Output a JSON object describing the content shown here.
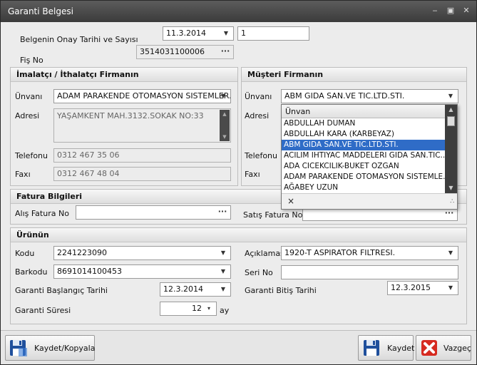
{
  "window": {
    "title": "Garanti Belgesi",
    "minimize": "‒",
    "restore": "▣",
    "close": "✕"
  },
  "header": {
    "onay_label": "Belgenin Onay Tarihi ve Sayısı",
    "onay_date": "11.3.2014",
    "onay_number": "1",
    "fis_label": "Fiş No",
    "fis_value": "3514031100006"
  },
  "imalatci": {
    "title": "İmalatçı / İthalatçı Firmanın",
    "unvan_label": "Ünvanı",
    "unvan_value": "ADAM PARAKENDE OTOMASYON SISTEMLER...",
    "adres_label": "Adresi",
    "adres_value": "YAŞAMKENT MAH.3132.SOKAK NO:33",
    "telefon_label": "Telefonu",
    "telefon_value": "0312 467 35 06",
    "fax_label": "Faxı",
    "fax_value": "0312 467 48 04"
  },
  "musteri": {
    "title": "Müşteri Firmanın",
    "unvan_label": "Ünvanı",
    "unvan_value": "ABM GIDA SAN.VE TIC.LTD.STI.",
    "adres_label": "Adresi",
    "telefon_label": "Telefonu",
    "fax_label": "Faxı"
  },
  "dropdown": {
    "header": "Ünvan",
    "items": [
      "ABDULLAH DUMAN",
      "ABDULLAH KARA (KARBEYAZ)",
      "ABM GIDA SAN.VE TIC.LTD.STI.",
      "ACILIM IHTIYAC MADDELERI GIDA SAN.TIC...",
      "ADA CICEKCILIK-BUKET OZGAN",
      "ADAM PARAKENDE OTOMASYON SISTEMLE...",
      "AĞABEY UZUN"
    ],
    "selected_index": 2,
    "clear": "×"
  },
  "fatura": {
    "title": "Fatura Bilgileri",
    "alis_label": "Alış Fatura No",
    "alis_value": "",
    "satis_label": "Satış Fatura No",
    "satis_value": ""
  },
  "urun": {
    "title": "Ürünün",
    "kodu_label": "Kodu",
    "kodu_value": "2241223090",
    "aciklama_label": "Açıklaması",
    "aciklama_value": "1920-T ASPIRATOR FILTRESI.",
    "barkod_label": "Barkodu",
    "barkod_value": "8691014100453",
    "seri_label": "Seri No",
    "seri_value": "",
    "baslangic_label": "Garanti Başlangıç Tarihi",
    "baslangic_value": "12.3.2014",
    "bitis_label": "Garanti Bitiş Tarihi",
    "bitis_value": "12.3.2015",
    "sure_label": "Garanti Süresi",
    "sure_value": "12",
    "sure_unit": "ay"
  },
  "buttons": {
    "kaydet_kopyala": "Kaydet/Kopyala",
    "kaydet": "Kaydet",
    "vazgec": "Vazgeç"
  },
  "glyphs": {
    "combo_arrow": "▼",
    "ellipsis": "···",
    "scroll_up": "▲",
    "scroll_down": "▼",
    "spin_arrow": "▾",
    "grip": "∴"
  },
  "colors": {
    "selection": "#2f6cc7",
    "titlebar": "#4a4a4a"
  }
}
